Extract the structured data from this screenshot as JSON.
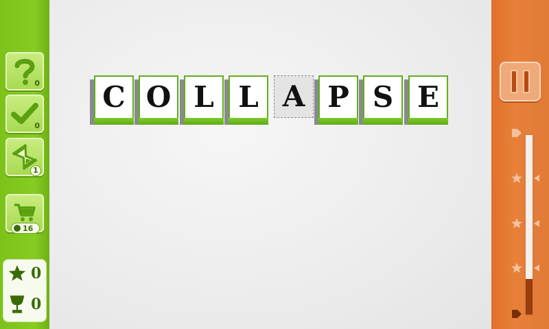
{
  "powerups": [
    {
      "name": "hint",
      "icon": "question-icon",
      "count": "0"
    },
    {
      "name": "check",
      "icon": "checkmark-icon",
      "count": "0"
    },
    {
      "name": "time",
      "icon": "hourglass-icon",
      "count": "1"
    }
  ],
  "shop": {
    "icon": "cart-icon",
    "coins": "16"
  },
  "score": {
    "stars": "0",
    "trophies": "0"
  },
  "word": {
    "letters": [
      "C",
      "O",
      "L",
      "L",
      "",
      "P",
      "S",
      "E"
    ],
    "ghost_letter": "A"
  },
  "meter": {
    "level": 0.2
  },
  "colors": {
    "left_bar": "#7cc21a",
    "right_bar": "#e07a34",
    "tile_base": "#6ebc22"
  }
}
